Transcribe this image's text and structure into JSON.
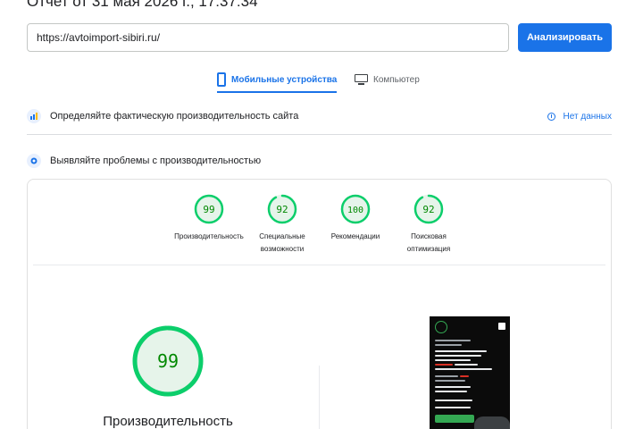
{
  "report": {
    "title": "Отчет от 31 мая 2026 г., 17:37:34"
  },
  "analyze": {
    "url_value": "https://avtoimport-sibiri.ru/",
    "button_label": "Анализировать"
  },
  "tabs": [
    {
      "label": "Мобильные устройства",
      "icon": "smartphone-icon",
      "active": true
    },
    {
      "label": "Компьютер",
      "icon": "desktop-icon",
      "active": false
    }
  ],
  "crux": {
    "title": "Определяйте фактическую производительность сайта",
    "no_data_label": "Нет данных",
    "icon": "field-data-icon"
  },
  "lab": {
    "title": "Выявляйте проблемы с производительностью",
    "icon": "lab-data-icon"
  },
  "scores": [
    {
      "value": 99,
      "label_line1": "Производительность",
      "label_line2": ""
    },
    {
      "value": 92,
      "label_line1": "Специальные",
      "label_line2": "возможности"
    },
    {
      "value": 100,
      "label_line1": "Рекомендации",
      "label_line2": ""
    },
    {
      "value": 92,
      "label_line1": "Поисковая",
      "label_line2": "оптимизация"
    }
  ],
  "main_score": {
    "value": 99,
    "label": "Производительность"
  },
  "colors": {
    "accent": "#1a73e8",
    "pass_green": "#0cce6b",
    "pass_text": "#008800",
    "pass_fill": "#e6f4ea"
  }
}
